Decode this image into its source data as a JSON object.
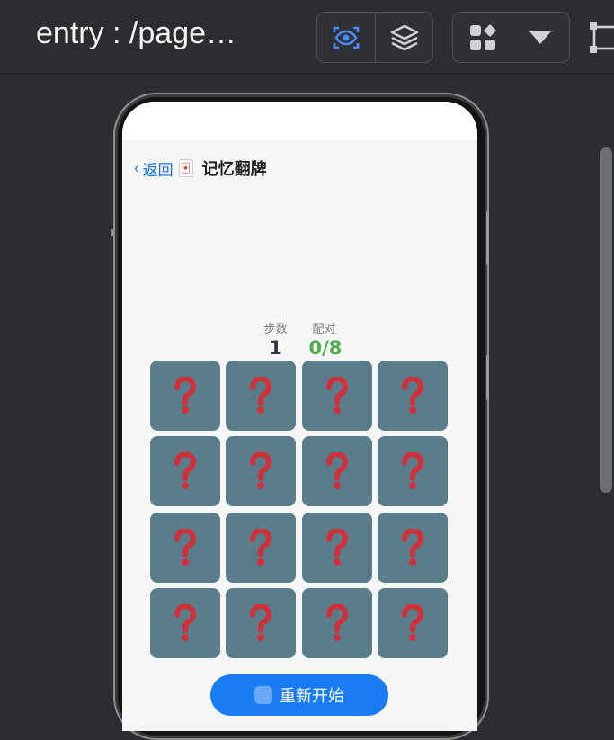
{
  "toolbar": {
    "title": "entry : /page…",
    "preview_icon": "eye-scan-icon",
    "layers_icon": "layers-icon",
    "components_icon": "components-icon",
    "dropdown_icon": "triangle-down-icon",
    "crop_icon": "crop-frame-icon"
  },
  "app": {
    "back_label": "返回",
    "back_icon": "chevron-left-icon",
    "title_icon": "joker-card-icon",
    "title": "记忆翻牌",
    "stats": {
      "steps_label": "步数",
      "steps_value": "1",
      "pairs_label": "配对",
      "pairs_value": "0/8"
    },
    "card_glyph": "❓",
    "card_count": 16,
    "restart_label": "重新开始"
  },
  "colors": {
    "accent": "#1a73e8",
    "card": "#5a7d8c",
    "pairs": "#4caf50",
    "button": "#1a7cf5",
    "active_icon": "#4a8cff"
  }
}
